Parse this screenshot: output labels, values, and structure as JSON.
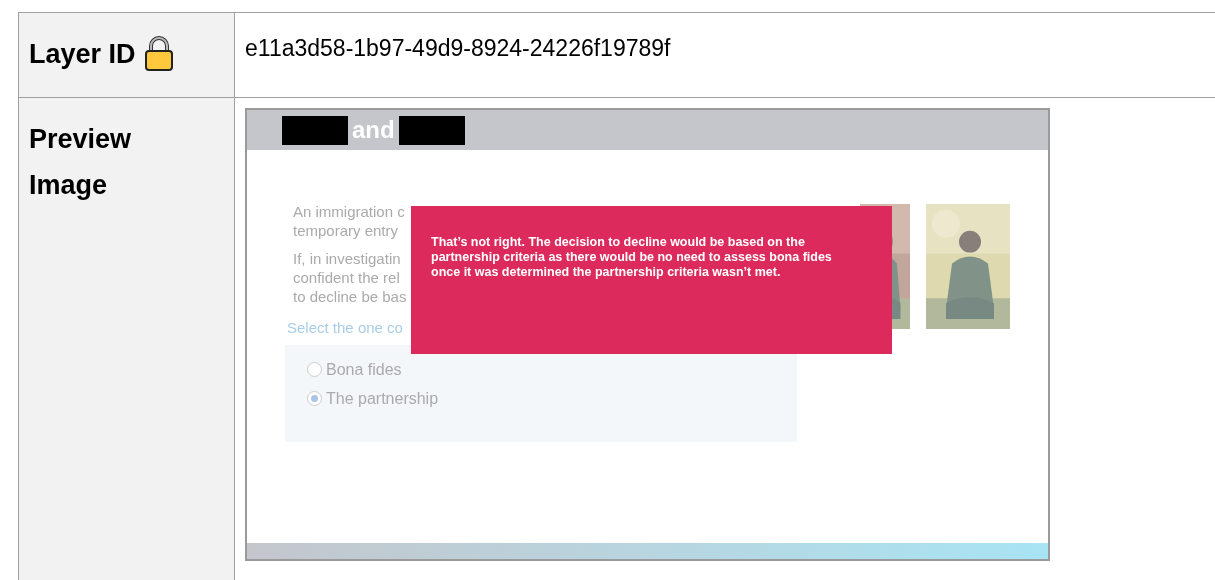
{
  "table": {
    "rows": [
      {
        "kind": "id",
        "label": "Layer ID",
        "value": "e11a3d58-1b97-49d9-8924-24226f19789f"
      },
      {
        "kind": "preview",
        "label": "Preview Image",
        "preview": {
          "header_text": "and",
          "lines": [
            "An immigration c",
            "temporary entry"
          ],
          "lines_2": [
            "If, in investigatin",
            "confident the rel",
            "to decline be bas"
          ],
          "prompt": "Select the one co",
          "options": [
            {
              "label": "Bona fides",
              "selected": false
            },
            {
              "label": "The partnership",
              "selected": true
            }
          ],
          "feedback": "That’s not right. The decision to decline would be based on the partnership criteria as there would be no need to assess bona fides once it was determined the partnership criteria wasn’t met."
        }
      }
    ]
  }
}
